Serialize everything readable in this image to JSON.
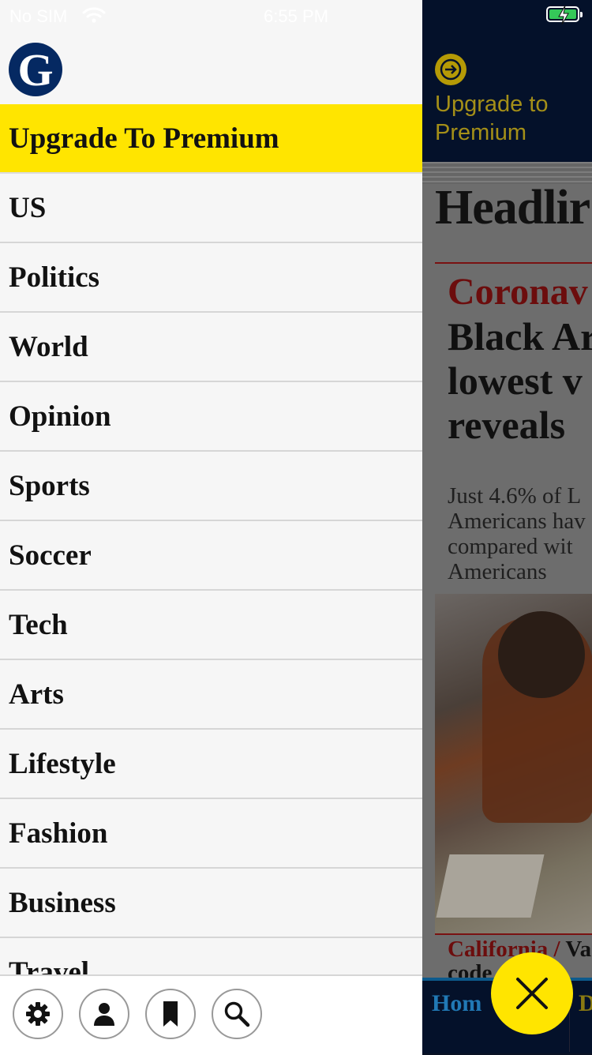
{
  "status_bar": {
    "carrier": "No SIM",
    "time": "6:55 PM"
  },
  "drawer": {
    "logo_letter": "G",
    "premium_label": "Upgrade To Premium",
    "sections": [
      "US",
      "Politics",
      "World",
      "Opinion",
      "Sports",
      "Soccer",
      "Tech",
      "Arts",
      "Lifestyle",
      "Fashion",
      "Business",
      "Travel"
    ],
    "toolbar_icons": [
      "gear-icon",
      "person-icon",
      "bookmark-icon",
      "search-icon"
    ]
  },
  "background": {
    "upgrade_text": "Upgrade to Premium",
    "section_heading": "Headlir",
    "kicker": "Coronav",
    "headline_lines": [
      "Black Ar",
      "lowest v",
      "reveals"
    ],
    "standfirst_lines": [
      "Just 4.6% of L",
      "Americans hav",
      "compared wit",
      "Americans"
    ],
    "next_kicker": "California /",
    "next_title_start": "Va",
    "next_title_line2": "code",
    "tab_home": "Hom",
    "tab_next": "D"
  },
  "colors": {
    "drawer_bg": "#f6f6f6",
    "premium_yellow": "#ffe500",
    "guardian_blue": "#052962",
    "headline_red": "#c70000"
  },
  "close_button_icon": "close-icon"
}
